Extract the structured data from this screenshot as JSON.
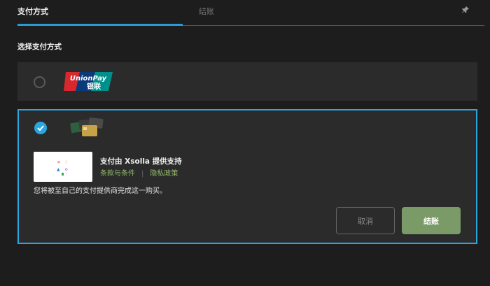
{
  "tabs": {
    "payment_method": "支付方式",
    "checkout": "结账"
  },
  "section": {
    "title": "选择支付方式"
  },
  "methods": {
    "unionpay": {
      "logo_text_top": "UnionPay",
      "logo_text_bottom": "银联"
    }
  },
  "provider": {
    "title": "支付由 Xsolla 提供支持",
    "terms": "条款与条件",
    "privacy": "隐私政策",
    "note": "您将被至自己的支付提供商完成这一购买。"
  },
  "buttons": {
    "cancel": "取消",
    "checkout": "结账"
  },
  "colors": {
    "accent": "#2aa6e0",
    "checkout_button": "#7a9b67",
    "link": "#8fb86a"
  }
}
